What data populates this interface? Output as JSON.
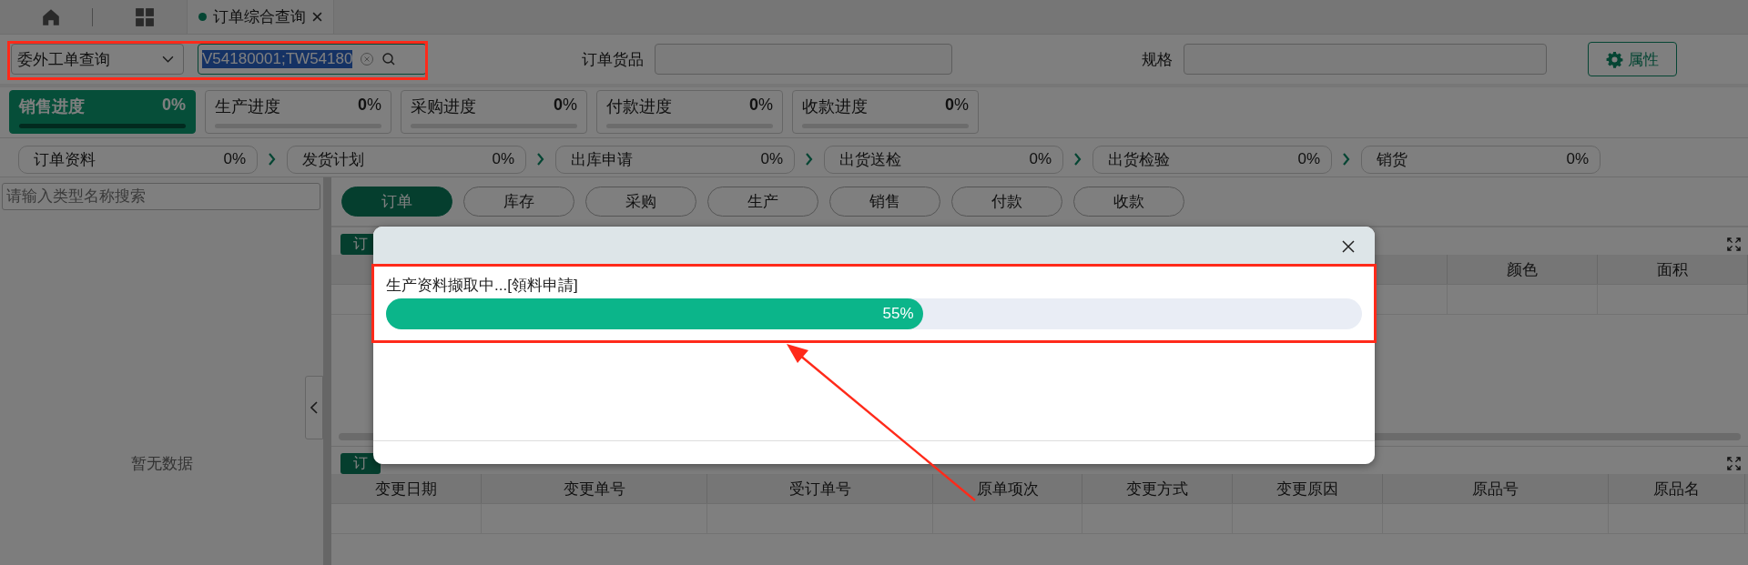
{
  "tab_bar": {
    "tabs": [
      {
        "label": "订单综合查询"
      }
    ]
  },
  "query": {
    "type": "委外工单查询",
    "value": "V54180001;TW54180"
  },
  "filters": [
    {
      "label": "订单货品"
    },
    {
      "label": "规格"
    }
  ],
  "properties_button": "属性",
  "progress_cards": [
    {
      "label": "销售进度",
      "percent": "**0**%",
      "level": 0,
      "selected": true
    },
    {
      "label": "生产进度",
      "percent": "**0**%",
      "level": 0,
      "selected": false
    },
    {
      "label": "采购进度",
      "percent": "**0**%",
      "level": 0,
      "selected": false
    },
    {
      "label": "付款进度",
      "percent": "**0**%",
      "level": 0,
      "selected": false
    },
    {
      "label": "收款进度",
      "percent": "**0**%",
      "level": 0,
      "selected": false
    }
  ],
  "steps": [
    {
      "label": "订单资料",
      "percent": "0%"
    },
    {
      "label": "发货计划",
      "percent": "0%"
    },
    {
      "label": "出库申请",
      "percent": "0%"
    },
    {
      "label": "出货送检",
      "percent": "0%"
    },
    {
      "label": "出货检验",
      "percent": "0%"
    },
    {
      "label": "销货",
      "percent": "0%"
    }
  ],
  "sidebar": {
    "search_placeholder": "请输入类型名称搜索",
    "empty_text": "暂无数据"
  },
  "doc_tabs": [
    {
      "label": "订单",
      "selected": true
    },
    {
      "label": "库存",
      "selected": false
    },
    {
      "label": "采购",
      "selected": false
    },
    {
      "label": "生产",
      "selected": false
    },
    {
      "label": "销售",
      "selected": false
    },
    {
      "label": "付款",
      "selected": false
    },
    {
      "label": "收款",
      "selected": false
    }
  ],
  "upper_table": {
    "tag": "订",
    "columns": [
      "颜色",
      "面积"
    ]
  },
  "lower_table": {
    "tag": "订",
    "columns": [
      "变更日期",
      "变更单号",
      "受订单号",
      "原单项次",
      "变更方式",
      "变更原因",
      "原品号",
      "原品名"
    ]
  },
  "dialog": {
    "message": "生产资料撷取中...[領料申請]",
    "level": 0.55,
    "reading": "55%"
  }
}
